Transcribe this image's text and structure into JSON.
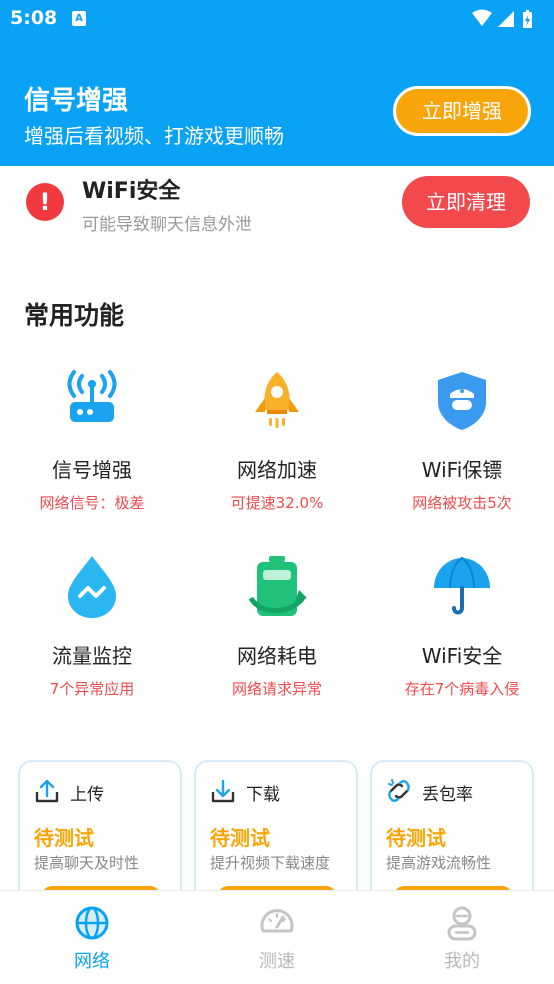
{
  "status_bar": {
    "time": "5:08",
    "a_icon": "A"
  },
  "header": {
    "title": "信号增强",
    "subtitle": "增强后看视频、打游戏更顺畅",
    "boost_button": "立即增强"
  },
  "alert": {
    "icon": "!",
    "title": "WiFi安全",
    "subtitle": "可能导致聊天信息外泄",
    "clean_button": "立即清理"
  },
  "section_title": "常用功能",
  "features": [
    {
      "name": "信号增强",
      "status": "网络信号：极差",
      "icon": "router-icon"
    },
    {
      "name": "网络加速",
      "status": "可提速32.0%",
      "icon": "rocket-icon"
    },
    {
      "name": "WiFi保镖",
      "status": "网络被攻击5次",
      "icon": "shield-guard-icon"
    },
    {
      "name": "流量监控",
      "status": "7个异常应用",
      "icon": "water-drop-icon"
    },
    {
      "name": "网络耗电",
      "status": "网络请求异常",
      "icon": "battery-icon"
    },
    {
      "name": "WiFi安全",
      "status": "存在7个病毒入侵",
      "icon": "umbrella-icon"
    }
  ],
  "cards": [
    {
      "title": "上传",
      "state": "待测试",
      "desc": "提高聊天及时性",
      "icon": "upload-icon"
    },
    {
      "title": "下载",
      "state": "待测试",
      "desc": "提升视频下载速度",
      "icon": "download-icon"
    },
    {
      "title": "丢包率",
      "state": "待测试",
      "desc": "提高游戏流畅性",
      "icon": "broken-link-icon"
    }
  ],
  "tabs": [
    {
      "label": "网络",
      "icon": "globe-icon",
      "active": true
    },
    {
      "label": "测速",
      "icon": "speedometer-icon",
      "active": false
    },
    {
      "label": "我的",
      "icon": "profile-icon",
      "active": false
    }
  ],
  "colors": {
    "primary": "#0aa2f5",
    "orange": "#f8a50a",
    "red": "#f24a4c"
  }
}
